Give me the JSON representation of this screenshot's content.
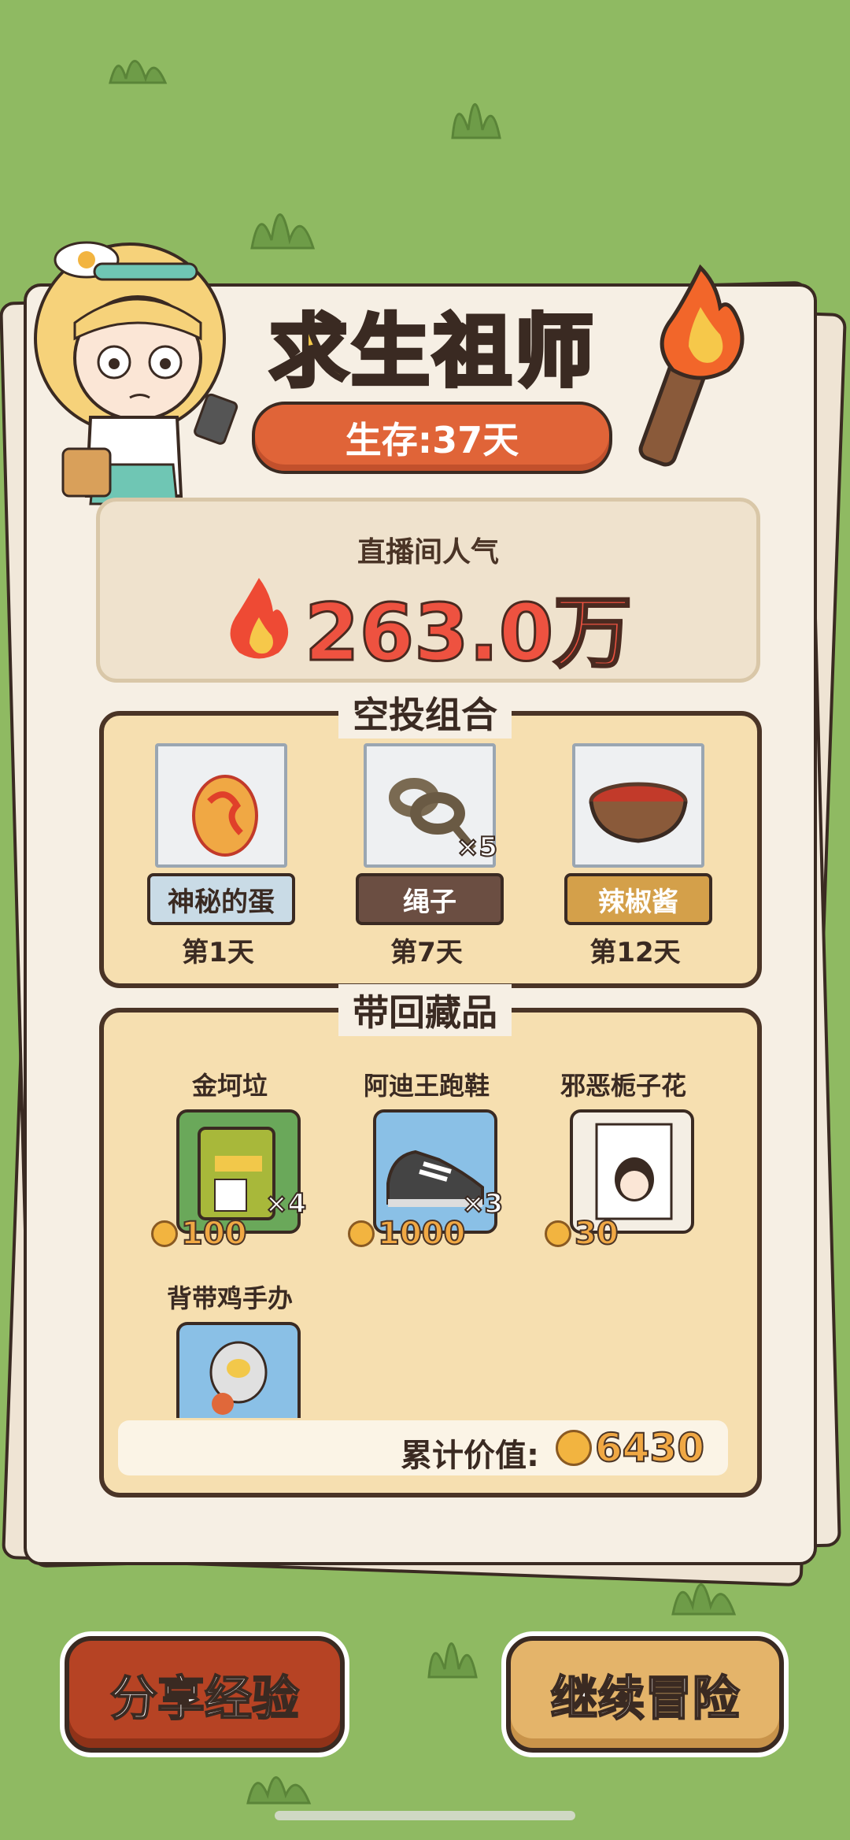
{
  "header": {
    "title": "求生祖师",
    "survival": "生存:37天"
  },
  "popularity": {
    "label": "直播间人气",
    "value": "263.0万"
  },
  "airdrop": {
    "title": "空投组合",
    "items": [
      {
        "name": "神秘的蛋",
        "day": "第1天",
        "count": "",
        "tag_color": "#c9dbe6",
        "text_color": "#3a2a22"
      },
      {
        "name": "绳子",
        "day": "第7天",
        "count": "×5",
        "tag_color": "#6b4e42",
        "text_color": "#ffffff"
      },
      {
        "name": "辣椒酱",
        "day": "第12天",
        "count": "",
        "tag_color": "#d4a04a",
        "text_color": "#ffffff"
      }
    ]
  },
  "collection": {
    "title": "带回藏品",
    "items": [
      {
        "name": "金坷垃",
        "value": "100",
        "count": "×4",
        "card_color": "#6aa85a"
      },
      {
        "name": "阿迪王跑鞋",
        "value": "1000",
        "count": "×3",
        "card_color": "#8ac0e6"
      },
      {
        "name": "邪恶栀子花",
        "value": "30",
        "count": "",
        "card_color": "#f4eee4"
      },
      {
        "name": "背带鸡手办",
        "value": "",
        "count": "",
        "card_color": "#8ac0e6"
      }
    ],
    "total_label": "累计价值:",
    "total_value": "6430"
  },
  "buttons": {
    "share": "分享经验",
    "continue": "继续冒险"
  }
}
